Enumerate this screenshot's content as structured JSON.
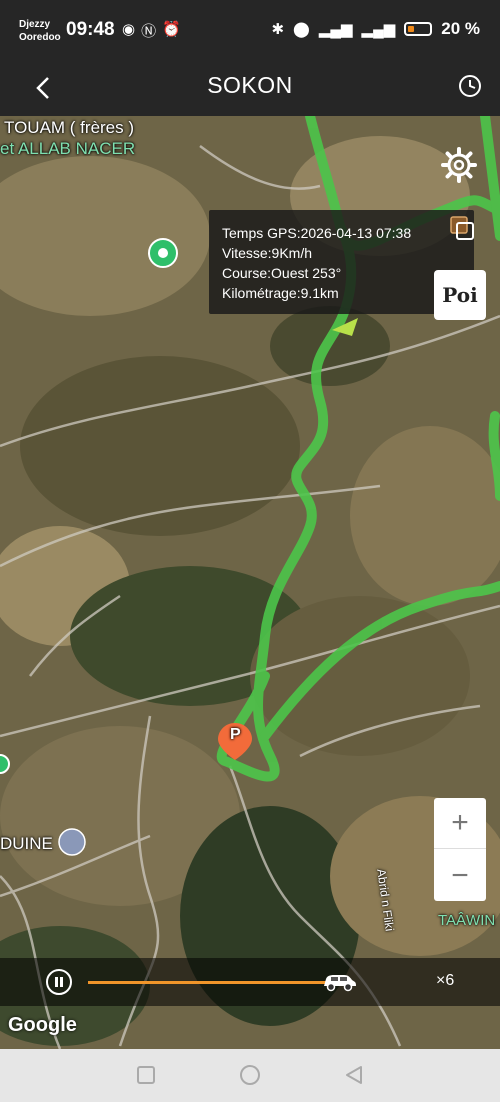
{
  "status": {
    "carrier1": "Djezzy",
    "carrier2": "Ooredoo",
    "time": "09:48",
    "battery": "20 %"
  },
  "header": {
    "title": "SOKON"
  },
  "map": {
    "labels": {
      "touam": "TOUAM ( frères )",
      "allab": "et ALLAB NACER",
      "ouine": "DUINE",
      "taawin": "TAÂWIN",
      "road": "Abrid n Fliki"
    },
    "poi_button": "Poi",
    "parking": "P"
  },
  "info": {
    "gps_time": "Temps GPS:2026-04-13 07:38",
    "speed": "Vitesse:9Km/h",
    "course": "Course:Ouest  253°",
    "mileage": "Kilométrage:9.1km"
  },
  "playback": {
    "speed": "×6",
    "progress": 0.93
  },
  "attribution": "Google",
  "colors": {
    "route": "#4cc54a",
    "progress": "#f0952a",
    "header": "#262626"
  }
}
